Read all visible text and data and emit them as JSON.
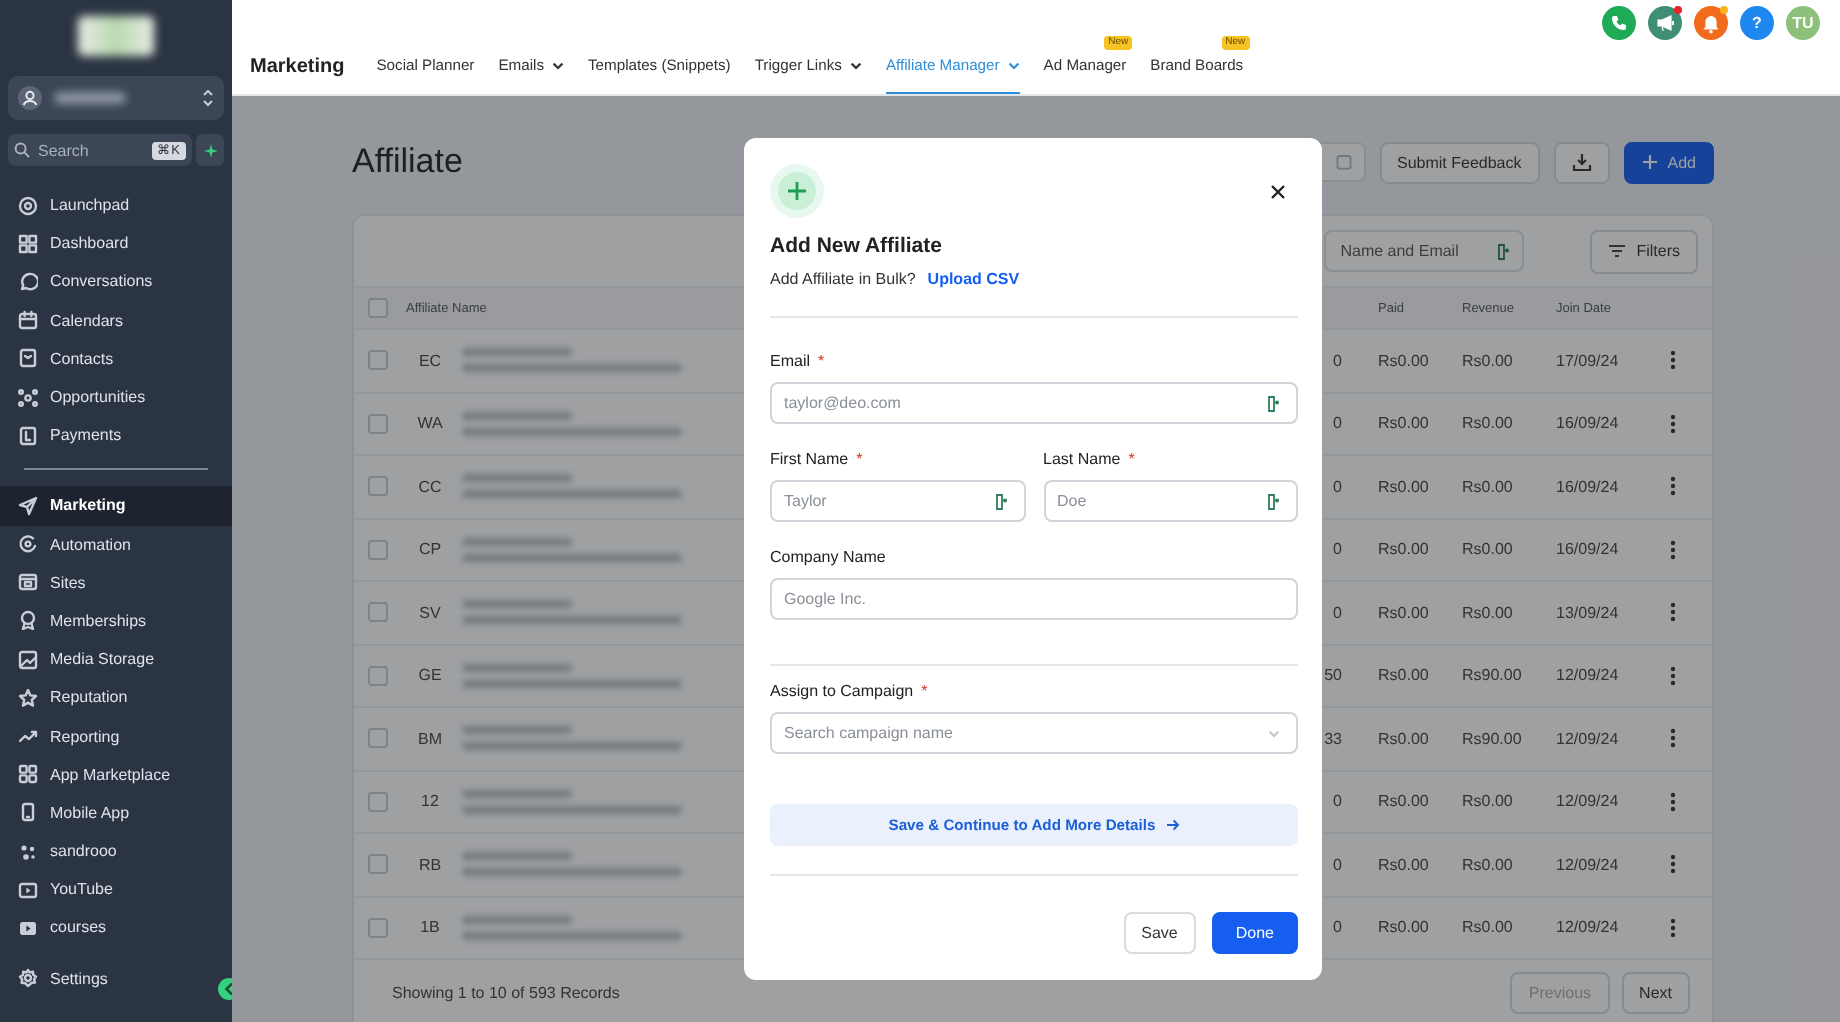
{
  "sidebar": {
    "search": {
      "placeholder": "Search",
      "shortcut": "⌘K"
    },
    "groups": [
      [
        {
          "label": "Launchpad",
          "selected": false
        },
        {
          "label": "Dashboard",
          "selected": false
        },
        {
          "label": "Conversations",
          "selected": false
        },
        {
          "label": "Calendars",
          "selected": false
        },
        {
          "label": "Contacts",
          "selected": false
        },
        {
          "label": "Opportunities",
          "selected": false
        },
        {
          "label": "Payments",
          "selected": false
        }
      ],
      [
        {
          "label": "Marketing",
          "selected": true
        },
        {
          "label": "Automation",
          "selected": false
        },
        {
          "label": "Sites",
          "selected": false
        },
        {
          "label": "Memberships",
          "selected": false
        },
        {
          "label": "Media Storage",
          "selected": false
        },
        {
          "label": "Reputation",
          "selected": false
        },
        {
          "label": "Reporting",
          "selected": false
        },
        {
          "label": "App Marketplace",
          "selected": false
        },
        {
          "label": "Mobile App",
          "selected": false
        },
        {
          "label": "sandrooo",
          "selected": false
        },
        {
          "label": "YouTube",
          "selected": false
        },
        {
          "label": "courses",
          "selected": false
        }
      ]
    ],
    "settings": {
      "label": "Settings",
      "selected": false
    }
  },
  "topnav": {
    "section": "Marketing",
    "tabs": [
      {
        "label": "Social Planner",
        "selected": false,
        "dropdown": false
      },
      {
        "label": "Emails",
        "selected": false,
        "dropdown": true
      },
      {
        "label": "Templates (Snippets)",
        "selected": false,
        "dropdown": false
      },
      {
        "label": "Trigger Links",
        "selected": false,
        "dropdown": true
      },
      {
        "label": "Affiliate Manager",
        "selected": true,
        "dropdown": true
      },
      {
        "label": "Ad Manager",
        "selected": false,
        "dropdown": false,
        "badge": "New"
      },
      {
        "label": "Brand Boards",
        "selected": false,
        "dropdown": false,
        "badge": "New"
      }
    ]
  },
  "header_actions": [
    {
      "kind": "phone",
      "color": "#1faa55",
      "dot": false
    },
    {
      "kind": "megaphone",
      "color": "#3f8f75",
      "dot": true
    },
    {
      "kind": "bell",
      "color": "#f26b1d",
      "dot": true
    },
    {
      "kind": "help",
      "color": "#1e88f0",
      "text": "?",
      "dot": false
    },
    {
      "kind": "avatar",
      "color": "#8dc07a",
      "text": "TU",
      "dot": false
    }
  ],
  "page": {
    "title": "Affiliate",
    "feedback_button": "Submit Feedback",
    "add_button": "Add"
  },
  "table": {
    "search": {
      "placeholder": "Name and Email"
    },
    "filters_button": "Filters",
    "columns": [
      "Affiliate Name",
      "Paid",
      "Revenue",
      "Join Date"
    ],
    "header_checked": false,
    "rows": [
      {
        "checked": false,
        "initials": "EC",
        "column_3": "0",
        "paid": "Rs0.00",
        "revenue": "Rs0.00",
        "join_date": "17/09/24"
      },
      {
        "checked": false,
        "initials": "WA",
        "column_3": "0",
        "paid": "Rs0.00",
        "revenue": "Rs0.00",
        "join_date": "16/09/24"
      },
      {
        "checked": false,
        "initials": "CC",
        "column_3": "0",
        "paid": "Rs0.00",
        "revenue": "Rs0.00",
        "join_date": "16/09/24"
      },
      {
        "checked": false,
        "initials": "CP",
        "column_3": "0",
        "paid": "Rs0.00",
        "revenue": "Rs0.00",
        "join_date": "16/09/24"
      },
      {
        "checked": false,
        "initials": "SV",
        "column_3": "0",
        "paid": "Rs0.00",
        "revenue": "Rs0.00",
        "join_date": "13/09/24"
      },
      {
        "checked": false,
        "initials": "GE",
        "column_3": "50",
        "paid": "Rs0.00",
        "revenue": "Rs90.00",
        "join_date": "12/09/24"
      },
      {
        "checked": false,
        "initials": "BM",
        "column_3": "33",
        "paid": "Rs0.00",
        "revenue": "Rs90.00",
        "join_date": "12/09/24"
      },
      {
        "checked": false,
        "initials": "12",
        "column_3": "0",
        "paid": "Rs0.00",
        "revenue": "Rs0.00",
        "join_date": "12/09/24"
      },
      {
        "checked": false,
        "initials": "RB",
        "column_3": "0",
        "paid": "Rs0.00",
        "revenue": "Rs0.00",
        "join_date": "12/09/24"
      },
      {
        "checked": false,
        "initials": "1B",
        "column_3": "0",
        "paid": "Rs0.00",
        "revenue": "Rs0.00",
        "join_date": "12/09/24"
      }
    ],
    "footer": "Showing 1 to 10 of 593 Records",
    "pagination": [
      {
        "label": "Previous",
        "disabled": true
      },
      {
        "label": "Next",
        "disabled": false
      }
    ]
  },
  "modal": {
    "title": "Add New Affiliate",
    "bulk_text": "Add Affiliate in Bulk?",
    "bulk_link": "Upload CSV",
    "field_rows": [
      [
        {
          "label": "Email",
          "required_mark": "*",
          "placeholder": "taylor@deo.com",
          "contact_icon": true
        }
      ],
      [
        {
          "label": "First Name",
          "required_mark": "*",
          "placeholder": "Taylor",
          "contact_icon": true
        },
        {
          "label": "Last Name",
          "required_mark": "*",
          "placeholder": "Doe",
          "contact_icon": true
        }
      ],
      [
        {
          "label": "Company Name",
          "placeholder": "Google Inc.",
          "contact_icon": false
        }
      ]
    ],
    "campaign": {
      "label": "Assign to Campaign",
      "required_mark": "*",
      "placeholder": "Search campaign name"
    },
    "continue_button": "Save & Continue to Add More Details",
    "save_button": "Save",
    "done_button": "Done"
  }
}
